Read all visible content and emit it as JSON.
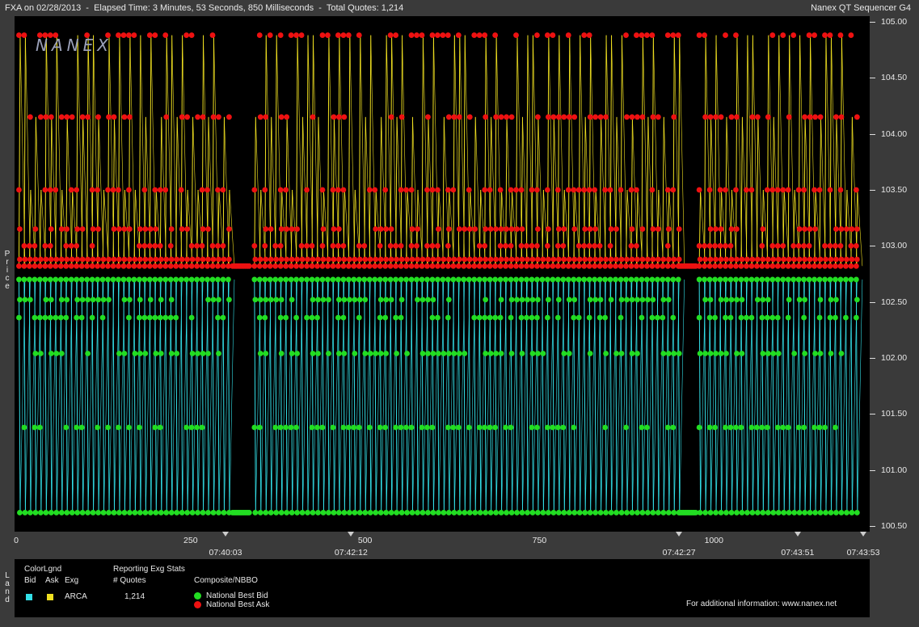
{
  "header": {
    "left": "FXA on 02/28/2013  -  Elapsed Time: 3 Minutes, 53 Seconds, 850 Milliseconds  -  Total Quotes: 1,214",
    "right": "Nanex QT Sequencer G4"
  },
  "side_labels": {
    "price": "Price",
    "land": "Land"
  },
  "logo": "NANEX",
  "colors": {
    "bid_line": "#33e0e8",
    "ask_line": "#f0e020",
    "bid_dot": "#22dd22",
    "ask_dot": "#ee1111",
    "plot_bg": "#000000"
  },
  "chart_data": {
    "type": "line",
    "title": "",
    "xlabel": "",
    "ylabel": "Price",
    "xlim": [
      0,
      1214
    ],
    "ylim": [
      100.45,
      105.05
    ],
    "x_ticks": [
      "0",
      "250",
      "500",
      "750",
      "1000"
    ],
    "x_tick_values": [
      0,
      250,
      500,
      750,
      1000
    ],
    "y_ticks": [
      "105.00",
      "104.50",
      "104.00",
      "103.50",
      "103.00",
      "102.50",
      "102.00",
      "101.50",
      "101.00",
      "100.50"
    ],
    "y_tick_values": [
      105.0,
      104.5,
      104.0,
      103.5,
      103.0,
      102.5,
      102.0,
      101.5,
      101.0,
      100.5
    ],
    "time_labels": [
      {
        "x": 300,
        "label": "07:40:03"
      },
      {
        "x": 480,
        "label": "07:42:12"
      },
      {
        "x": 950,
        "label": "07:42:27"
      },
      {
        "x": 1120,
        "label": "07:43:51"
      },
      {
        "x": 1214,
        "label": "07:43:53"
      }
    ],
    "ask_levels": [
      104.88,
      104.15,
      103.5,
      103.15,
      103.0,
      102.88,
      102.82
    ],
    "bid_levels": [
      102.7,
      102.52,
      102.36,
      102.04,
      101.38,
      100.62
    ],
    "ask_base": 102.82,
    "bid_base": 102.7,
    "gaps": [
      [
        310,
        335
      ],
      [
        950,
        975
      ]
    ],
    "series": [
      {
        "name": "National Best Bid",
        "range": [
          100.62,
          102.72
        ]
      },
      {
        "name": "National Best Ask",
        "range": [
          102.8,
          104.9
        ]
      }
    ]
  },
  "legend": {
    "colorlgnd_title": "ColorLgnd",
    "col_bid": "Bid",
    "col_ask": "Ask",
    "col_exg": "Exg",
    "exchange": "ARCA",
    "stats_title": "Reporting Exg Stats",
    "quotes_header": "# Quotes",
    "quotes_value": "1,214",
    "composite_title": "Composite/NBBO",
    "nbb_label": "National Best Bid",
    "nba_label": "National Best Ask",
    "footer": "For additional information: www.nanex.net"
  }
}
